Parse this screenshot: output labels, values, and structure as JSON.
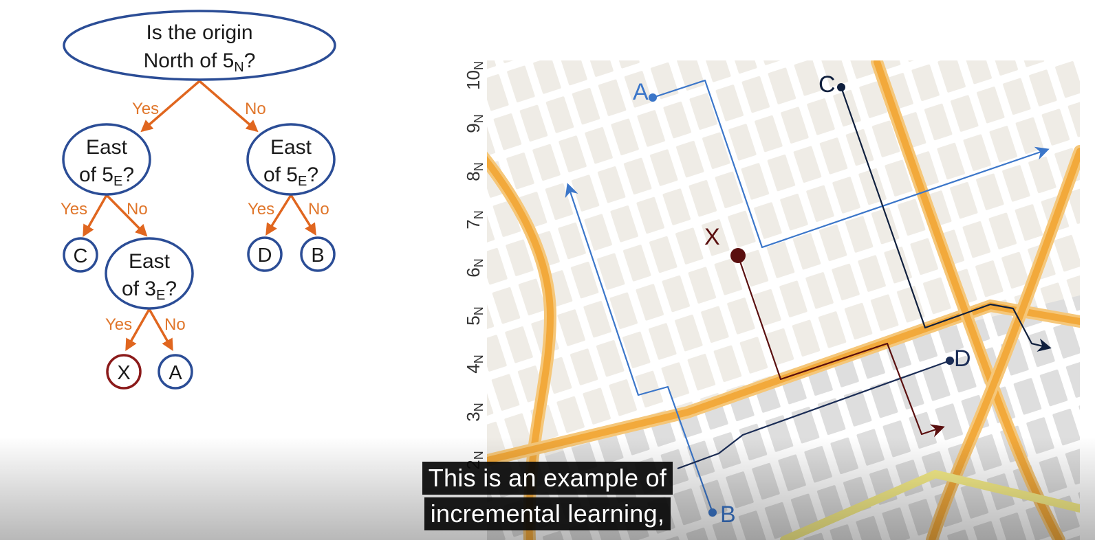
{
  "colors": {
    "node_border": "#2b4d96",
    "target_border": "#8b1a1a",
    "tree_arrow": "#e0661f",
    "edge_label": "#e0762b",
    "route_A": "#3b76c9",
    "route_C": "#0f1f3d",
    "route_D": "#1a2c55",
    "route_X": "#5a0f0f",
    "highway": "#f2a93b",
    "map_block": "#efece6",
    "map_block_gray": "#dedede",
    "map_street": "#ffffff"
  },
  "tree": {
    "root": {
      "line1": "Is the origin",
      "line2": "North of 5",
      "sub": "N",
      "tail": "?"
    },
    "left_question": {
      "line1": "East",
      "line2": "of 5",
      "sub": "E",
      "tail": "?"
    },
    "right_question": {
      "line1": "East",
      "line2": "of 5",
      "sub": "E",
      "tail": "?"
    },
    "lower_question": {
      "line1": "East",
      "line2": "of 3",
      "sub": "E",
      "tail": "?"
    },
    "edges": {
      "root_yes": "Yes",
      "root_no": "No",
      "left_yes": "Yes",
      "left_no": "No",
      "right_yes": "Yes",
      "right_no": "No",
      "lower_yes": "Yes",
      "lower_no": "No"
    },
    "leaves": {
      "c": "C",
      "d": "D",
      "b": "B",
      "x": "X",
      "a": "A"
    }
  },
  "map": {
    "axis_ticks": [
      {
        "num": "10",
        "sub": "N"
      },
      {
        "num": "9",
        "sub": "N"
      },
      {
        "num": "8",
        "sub": "N"
      },
      {
        "num": "7",
        "sub": "N"
      },
      {
        "num": "6",
        "sub": "N"
      },
      {
        "num": "5",
        "sub": "N"
      },
      {
        "num": "4",
        "sub": "N"
      },
      {
        "num": "3",
        "sub": "N"
      },
      {
        "num": "2",
        "sub": "N"
      }
    ],
    "points": {
      "a": "A",
      "b": "B",
      "c": "C",
      "d": "D",
      "x": "X"
    }
  },
  "captions": {
    "line1": "This is an example of",
    "line2": "incremental learning,"
  }
}
